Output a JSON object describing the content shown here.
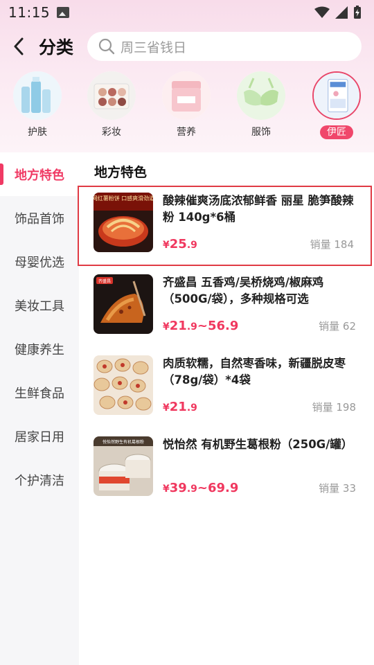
{
  "status_bar": {
    "time": "11:15"
  },
  "header": {
    "title": "分类",
    "search_placeholder": "周三省钱日"
  },
  "categories": [
    {
      "label": "护肤",
      "icon": "skincare-bottles-icon"
    },
    {
      "label": "彩妆",
      "icon": "makeup-palette-icon"
    },
    {
      "label": "营养",
      "icon": "nutrition-jar-icon"
    },
    {
      "label": "服饰",
      "icon": "bra-clothing-icon"
    },
    {
      "label": "伊匠",
      "icon": "milk-box-icon",
      "active": true
    }
  ],
  "sidebar": {
    "items": [
      {
        "label": "地方特色",
        "active": true
      },
      {
        "label": "饰品首饰"
      },
      {
        "label": "母婴优选"
      },
      {
        "label": "美妆工具"
      },
      {
        "label": "健康养生"
      },
      {
        "label": "生鲜食品"
      },
      {
        "label": "居家日用"
      },
      {
        "label": "个护清洁"
      }
    ]
  },
  "section_title": "地方特色",
  "products": [
    {
      "name": "酸辣催爽汤底浓郁鲜香 丽星 脆笋酸辣粉 140g*6桶",
      "price_symbol": "¥",
      "price_main": "25",
      "price_dec": ".9",
      "price_range": "",
      "sales_label": "销量 184",
      "thumb_text": "网红薯粉饼 口感爽滑劲道",
      "selected": true
    },
    {
      "name": "齐盛昌 五香鸡/吴桥烧鸡/椒麻鸡（500G/袋），多种规格可选",
      "price_symbol": "¥",
      "price_main": "21",
      "price_dec": ".9",
      "price_range": "~56.9",
      "sales_label": "销量 62",
      "thumb_text": "齐盛昌"
    },
    {
      "name": "肉质软糯，自然枣香味，新疆脱皮枣（78g/袋）*4袋",
      "price_symbol": "¥",
      "price_main": "21",
      "price_dec": ".9",
      "price_range": "",
      "sales_label": "销量 198",
      "thumb_text": ""
    },
    {
      "name": "悦怡然 有机野生葛根粉（250G/罐）",
      "price_symbol": "¥",
      "price_main": "39",
      "price_dec": ".9",
      "price_range": "~69.9",
      "sales_label": "销量 33",
      "thumb_text": "悦怡然野生有机葛根粉"
    }
  ],
  "colors": {
    "accent": "#f03a64",
    "selected_border": "#e03a44"
  }
}
